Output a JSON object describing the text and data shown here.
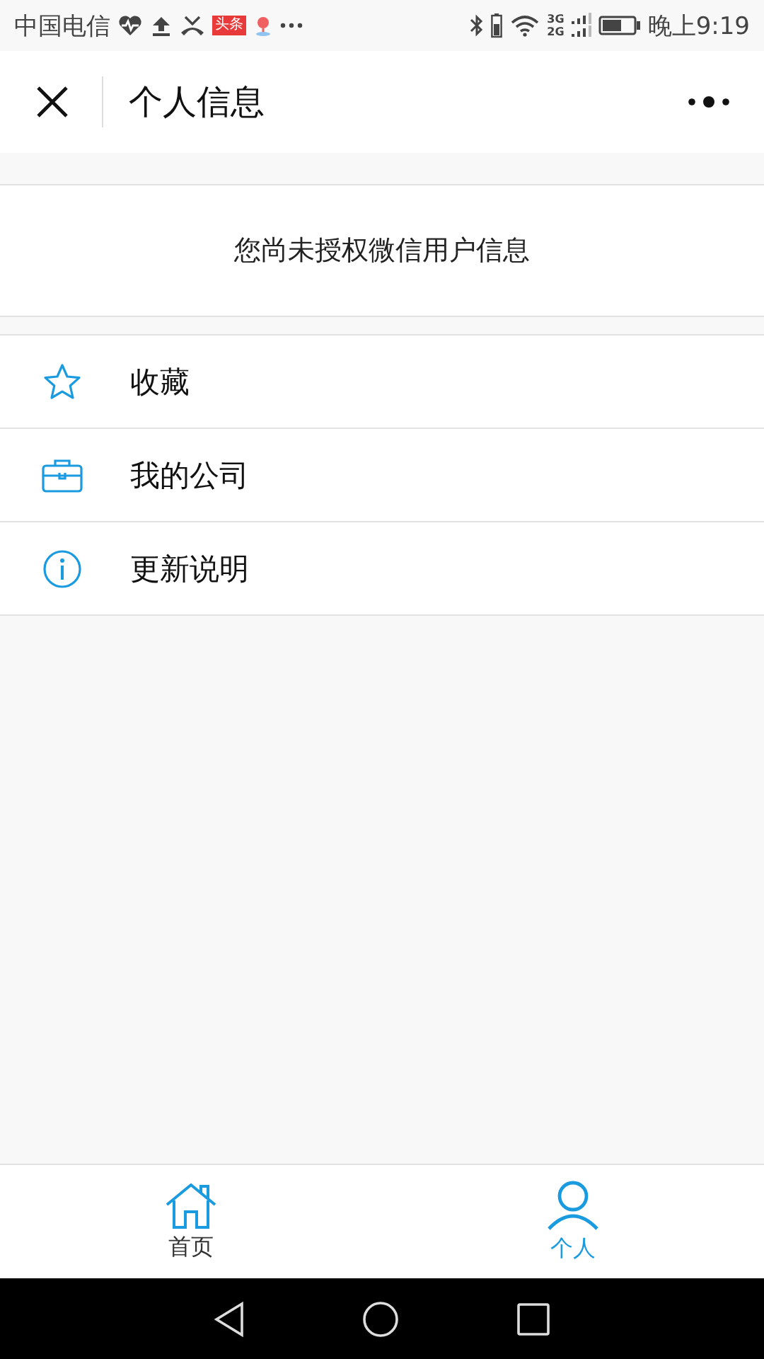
{
  "status_bar": {
    "carrier": "中国电信",
    "badge": "头条",
    "net_top": "3G",
    "net_bottom": "2G",
    "time": "晚上9:19"
  },
  "header": {
    "title": "个人信息"
  },
  "auth_notice": "您尚未授权微信用户信息",
  "menu": [
    {
      "kind": "star",
      "label": "收藏"
    },
    {
      "kind": "briefcase",
      "label": "我的公司"
    },
    {
      "kind": "info",
      "label": "更新说明"
    }
  ],
  "tabs": [
    {
      "kind": "home",
      "label": "首页",
      "selected": false
    },
    {
      "kind": "person",
      "label": "个人",
      "selected": true
    }
  ]
}
